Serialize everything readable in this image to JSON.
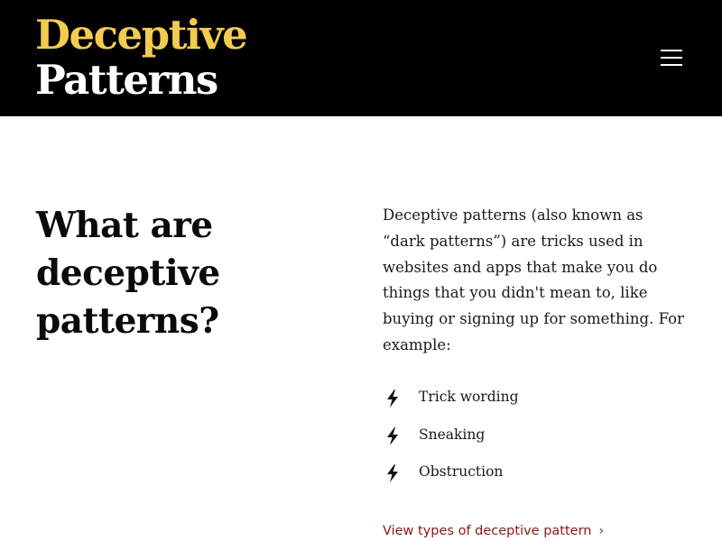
{
  "header": {
    "logo_line1": "Deceptive",
    "logo_line2": "Patterns",
    "menu_icon": "hamburger-menu-icon",
    "colors": {
      "background": "#000000",
      "logo_accent": "#f2cc4e",
      "logo_text": "#ffffff"
    }
  },
  "main": {
    "heading": "What are deceptive patterns?",
    "intro": "Deceptive patterns (also known as “dark patterns”) are tricks used in websites and apps that make you do things that you didn't mean to, like buying or signing up for something. For example:",
    "examples": [
      {
        "label": "Trick wording",
        "icon": "lightning-bolt-icon"
      },
      {
        "label": "Sneaking",
        "icon": "lightning-bolt-icon"
      },
      {
        "label": "Obstruction",
        "icon": "lightning-bolt-icon"
      }
    ],
    "link": {
      "label": "View types of deceptive pattern",
      "icon": "chevron-right-icon",
      "color": "#8a1717"
    }
  }
}
